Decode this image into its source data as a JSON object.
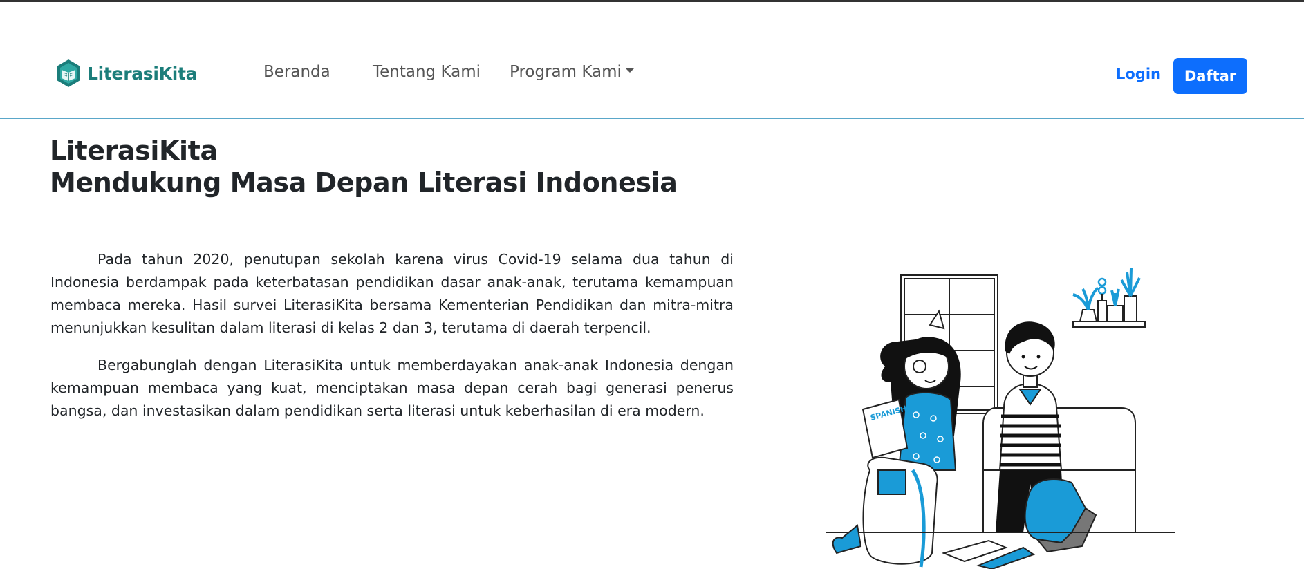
{
  "brand": {
    "name": "LiterasiKita",
    "color": "#1b7d7a"
  },
  "nav": {
    "items": [
      {
        "label": "Beranda"
      },
      {
        "label": "Tentang Kami"
      },
      {
        "label": "Program Kami"
      }
    ],
    "login_label": "Login",
    "register_label": "Daftar",
    "accent": "#0d6efd"
  },
  "hero": {
    "title_line1": "LiterasiKita",
    "title_line2": "Mendukung Masa Depan Literasi Indonesia",
    "paragraphs": [
      "Pada tahun 2020, penutupan sekolah karena virus Covid-19 selama dua tahun di Indonesia berdampak pada keterbatasan pendidikan dasar anak-anak, terutama kemampuan membaca mereka. Hasil survei LiterasiKita bersama Kementerian Pendidikan dan mitra-mitra menunjukkan kesulitan dalam literasi di kelas 2 dan 3, terutama di daerah terpencil.",
      "Bergabunglah dengan LiterasiKita untuk memberdayakan anak-anak Indonesia dengan kemampuan membaca yang kuat, menciptakan masa depan cerah bagi generasi penerus bangsa, dan investasikan dalam pendidikan serta literasi untuk keberhasilan di era modern."
    ]
  },
  "illustration": {
    "book_label": "SPANISH",
    "accent": "#1a9bd7"
  }
}
